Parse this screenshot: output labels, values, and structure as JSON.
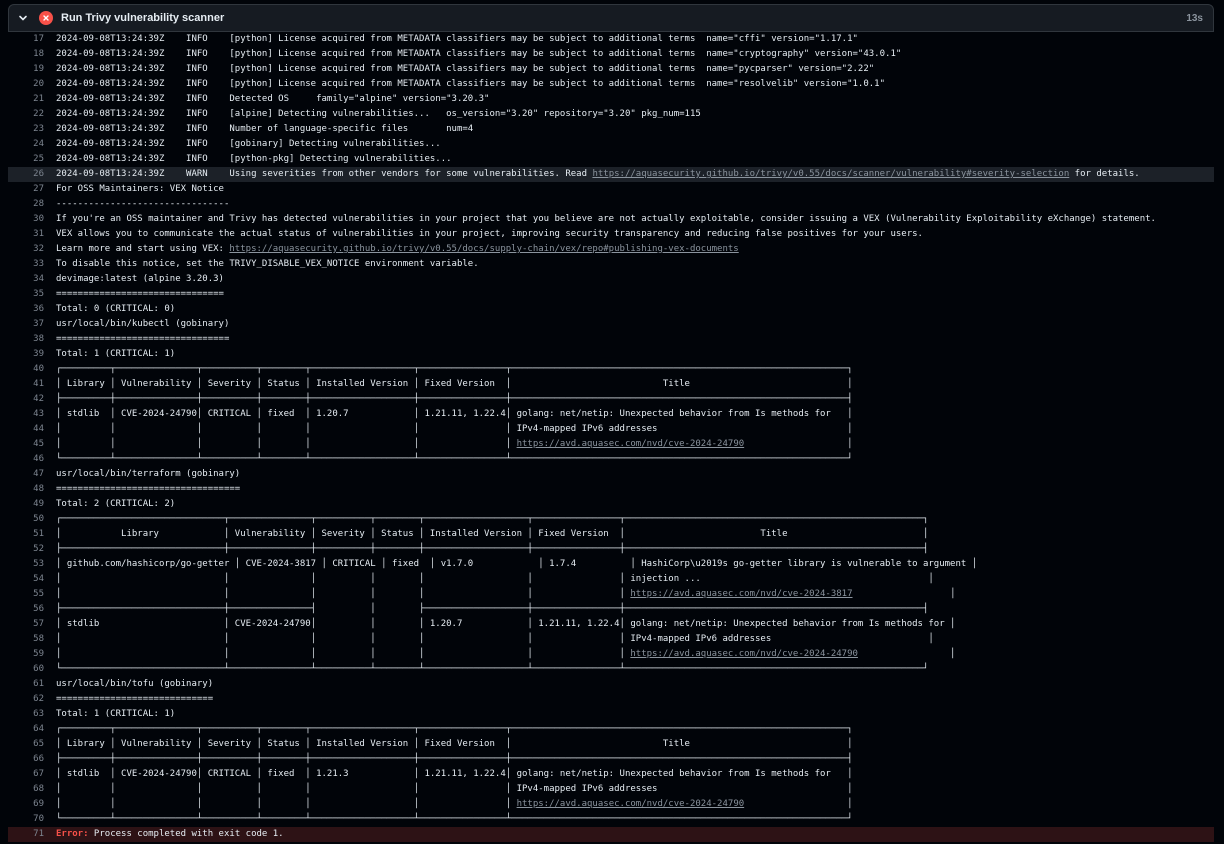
{
  "step": {
    "title": "Run Trivy vulnerability scanner",
    "duration": "13s"
  },
  "lines": [
    {
      "n": "17",
      "t": "2024-09-08T13:24:39Z    INFO    [python] License acquired from METADATA classifiers may be subject to additional terms  name=\"cffi\" version=\"1.17.1\""
    },
    {
      "n": "18",
      "t": "2024-09-08T13:24:39Z    INFO    [python] License acquired from METADATA classifiers may be subject to additional terms  name=\"cryptography\" version=\"43.0.1\""
    },
    {
      "n": "19",
      "t": "2024-09-08T13:24:39Z    INFO    [python] License acquired from METADATA classifiers may be subject to additional terms  name=\"pycparser\" version=\"2.22\""
    },
    {
      "n": "20",
      "t": "2024-09-08T13:24:39Z    INFO    [python] License acquired from METADATA classifiers may be subject to additional terms  name=\"resolvelib\" version=\"1.0.1\""
    },
    {
      "n": "21",
      "t": "2024-09-08T13:24:39Z    INFO    Detected OS     family=\"alpine\" version=\"3.20.3\""
    },
    {
      "n": "22",
      "t": "2024-09-08T13:24:39Z    INFO    [alpine] Detecting vulnerabilities...   os_version=\"3.20\" repository=\"3.20\" pkg_num=115"
    },
    {
      "n": "23",
      "t": "2024-09-08T13:24:39Z    INFO    Number of language-specific files       num=4"
    },
    {
      "n": "24",
      "t": "2024-09-08T13:24:39Z    INFO    [gobinary] Detecting vulnerabilities..."
    },
    {
      "n": "25",
      "t": "2024-09-08T13:24:39Z    INFO    [python-pkg] Detecting vulnerabilities..."
    },
    {
      "n": "26",
      "t": "2024-09-08T13:24:39Z    WARN    Using severities from other vendors for some vulnerabilities. Read ",
      "link": "https://aquasecurity.github.io/trivy/v0.55/docs/scanner/vulnerability#severity-selection",
      "after": " for details.",
      "hl": true
    },
    {
      "n": "27",
      "t": "For OSS Maintainers: VEX Notice"
    },
    {
      "n": "28",
      "t": "--------------------------------"
    },
    {
      "n": "30",
      "t": "If you're an OSS maintainer and Trivy has detected vulnerabilities in your project that you believe are not actually exploitable, consider issuing a VEX (Vulnerability Exploitability eXchange) statement."
    },
    {
      "n": "31",
      "t": "VEX allows you to communicate the actual status of vulnerabilities in your project, improving security transparency and reducing false positives for your users."
    },
    {
      "n": "32",
      "t": "Learn more and start using VEX: ",
      "link": "https://aquasecurity.github.io/trivy/v0.55/docs/supply-chain/vex/repo#publishing-vex-documents",
      "after": ""
    },
    {
      "n": "33",
      "t": "To disable this notice, set the TRIVY_DISABLE_VEX_NOTICE environment variable."
    },
    {
      "n": "34",
      "t": "devimage:latest (alpine 3.20.3)"
    },
    {
      "n": "35",
      "t": "==============================="
    },
    {
      "n": "36",
      "t": "Total: 0 (CRITICAL: 0)"
    },
    {
      "n": "37",
      "t": "usr/local/bin/kubectl (gobinary)"
    },
    {
      "n": "38",
      "t": "================================"
    },
    {
      "n": "39",
      "t": "Total: 1 (CRITICAL: 1)"
    },
    {
      "n": "40",
      "t": "┌─────────┬───────────────┬──────────┬────────┬───────────────────┬────────────────┬──────────────────────────────────────────────────────────────┐"
    },
    {
      "n": "41",
      "t": "│ Library │ Vulnerability │ Severity │ Status │ Installed Version │ Fixed Version  │                            Title                             │"
    },
    {
      "n": "42",
      "t": "├─────────┼───────────────┼──────────┼────────┼───────────────────┼────────────────┼──────────────────────────────────────────────────────────────┤"
    },
    {
      "n": "43",
      "t": "│ stdlib  │ CVE-2024-24790│ CRITICAL │ fixed  │ 1.20.7            │ 1.21.11, 1.22.4│ golang: net/netip: Unexpected behavior from Is methods for   │"
    },
    {
      "n": "44",
      "t": "│         │               │          │        │                   │                │ IPv4-mapped IPv6 addresses                                   │"
    },
    {
      "n": "45",
      "t": "│         │               │          │        │                   │                │ ",
      "link": "https://avd.aquasec.com/nvd/cve-2024-24790",
      "after": "                   │"
    },
    {
      "n": "46",
      "t": "└─────────┴───────────────┴──────────┴────────┴───────────────────┴────────────────┴──────────────────────────────────────────────────────────────┘"
    },
    {
      "n": "47",
      "t": "usr/local/bin/terraform (gobinary)"
    },
    {
      "n": "48",
      "t": "=================================="
    },
    {
      "n": "49",
      "t": "Total: 2 (CRITICAL: 2)"
    },
    {
      "n": "50",
      "t": "┌──────────────────────────────┬───────────────┬──────────┬────────┬───────────────────┬────────────────┬───────────────────────────────────────────────────────┐"
    },
    {
      "n": "51",
      "t": "│           Library            │ Vulnerability │ Severity │ Status │ Installed Version │ Fixed Version  │                         Title                         │"
    },
    {
      "n": "52",
      "t": "├──────────────────────────────┼───────────────┼──────────┼────────┼───────────────────┼────────────────┼───────────────────────────────────────────────────────┤"
    },
    {
      "n": "53",
      "t": "│ github.com/hashicorp/go-getter │ CVE-2024-3817 │ CRITICAL │ fixed  │ v1.7.0            │ 1.7.4          │ HashiCorp\\u2019s go-getter library is vulnerable to argument │"
    },
    {
      "n": "54",
      "t": "│                              │               │          │        │                   │                │ injection ...                                          │"
    },
    {
      "n": "55",
      "t": "│                              │               │          │        │                   │                │ ",
      "link": "https://avd.aquasec.com/nvd/cve-2024-3817",
      "after": "                  │"
    },
    {
      "n": "56",
      "t": "├──────────────────────────────┼───────────────┤          │        ├───────────────────┼────────────────┼───────────────────────────────────────────────────────┤"
    },
    {
      "n": "57",
      "t": "│ stdlib                       │ CVE-2024-24790│          │        │ 1.20.7            │ 1.21.11, 1.22.4│ golang: net/netip: Unexpected behavior from Is methods for │"
    },
    {
      "n": "58",
      "t": "│                              │               │          │        │                   │                │ IPv4-mapped IPv6 addresses                             │"
    },
    {
      "n": "59",
      "t": "│                              │               │          │        │                   │                │ ",
      "link": "https://avd.aquasec.com/nvd/cve-2024-24790",
      "after": "                 │"
    },
    {
      "n": "60",
      "t": "└──────────────────────────────┴───────────────┴──────────┴────────┴───────────────────┴────────────────┴───────────────────────────────────────────────────────┘"
    },
    {
      "n": "61",
      "t": "usr/local/bin/tofu (gobinary)"
    },
    {
      "n": "62",
      "t": "============================="
    },
    {
      "n": "63",
      "t": "Total: 1 (CRITICAL: 1)"
    },
    {
      "n": "64",
      "t": "┌─────────┬───────────────┬──────────┬────────┬───────────────────┬────────────────┬──────────────────────────────────────────────────────────────┐"
    },
    {
      "n": "65",
      "t": "│ Library │ Vulnerability │ Severity │ Status │ Installed Version │ Fixed Version  │                            Title                             │"
    },
    {
      "n": "66",
      "t": "├─────────┼───────────────┼──────────┼────────┼───────────────────┼────────────────┼──────────────────────────────────────────────────────────────┤"
    },
    {
      "n": "67",
      "t": "│ stdlib  │ CVE-2024-24790│ CRITICAL │ fixed  │ 1.21.3            │ 1.21.11, 1.22.4│ golang: net/netip: Unexpected behavior from Is methods for   │"
    },
    {
      "n": "68",
      "t": "│         │               │          │        │                   │                │ IPv4-mapped IPv6 addresses                                   │"
    },
    {
      "n": "69",
      "t": "│         │               │          │        │                   │                │ ",
      "link": "https://avd.aquasec.com/nvd/cve-2024-24790",
      "after": "                   │"
    },
    {
      "n": "70",
      "t": "└─────────┴───────────────┴──────────┴────────┴───────────────────┴────────────────┴──────────────────────────────────────────────────────────────┘"
    }
  ],
  "error_line": {
    "n": "71",
    "label": "Error:",
    "message": " Process completed with exit code 1."
  },
  "colors": {
    "error": "#f85149",
    "link": "#8b949e",
    "background": "#010409"
  }
}
